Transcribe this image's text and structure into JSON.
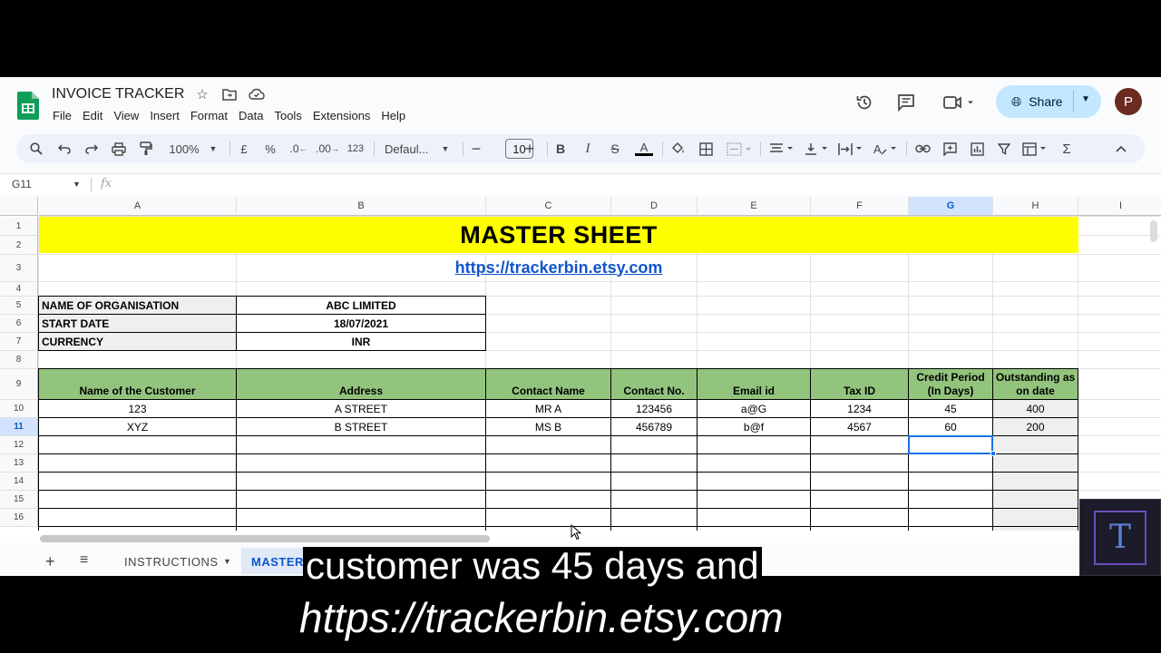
{
  "app": {
    "title": "INVOICE TRACKER",
    "menu": [
      "File",
      "Edit",
      "View",
      "Insert",
      "Format",
      "Data",
      "Tools",
      "Extensions",
      "Help"
    ],
    "share_label": "Share",
    "avatar_letter": "P"
  },
  "toolbar": {
    "zoom": "100%",
    "currency": "£",
    "percent": "%",
    "dec_decrease": ".0",
    "dec_increase": ".00",
    "number_format": "123",
    "font": "Defaul...",
    "font_size": "10"
  },
  "formula_bar": {
    "name_box": "G11",
    "fx": "fx"
  },
  "columns": [
    "A",
    "B",
    "C",
    "D",
    "E",
    "F",
    "G",
    "H",
    "I"
  ],
  "rows": [
    "1",
    "2",
    "3",
    "4",
    "5",
    "6",
    "7",
    "8",
    "9",
    "10",
    "11",
    "12",
    "13",
    "14",
    "15",
    "16"
  ],
  "sheet": {
    "title": "MASTER SHEET",
    "link": "https://trackerbin.etsy.com",
    "info": [
      {
        "label": "NAME OF ORGANISATION",
        "value": "ABC LIMITED"
      },
      {
        "label": "START DATE",
        "value": "18/07/2021"
      },
      {
        "label": "CURRENCY",
        "value": "INR"
      }
    ],
    "headers": [
      "Name of the Customer",
      "Address",
      "Contact Name",
      "Contact No.",
      "Email id",
      "Tax ID",
      "Credit Period (In Days)",
      "Outstanding as on date"
    ],
    "data": [
      [
        "123",
        "A STREET",
        "MR A",
        "123456",
        "a@G",
        "1234",
        "45",
        "400"
      ],
      [
        "XYZ",
        "B STREET",
        "MS B",
        "456789",
        "b@f",
        "4567",
        "60",
        "200"
      ]
    ]
  },
  "tabs": [
    "INSTRUCTIONS",
    "MASTER"
  ],
  "captions": {
    "line1": "customer was 45 days and",
    "line2": "https://trackerbin.etsy.com"
  },
  "watermark": "T"
}
